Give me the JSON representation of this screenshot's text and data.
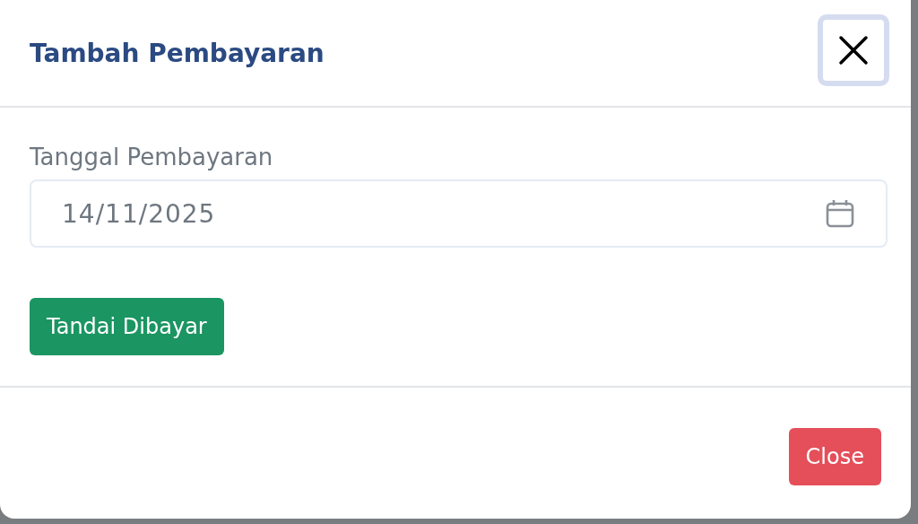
{
  "modal": {
    "title": "Tambah Pembayaran",
    "date_field": {
      "label": "Tanggal Pembayaran",
      "value": "14/11/2025"
    },
    "primary_button": "Tandai Dibayar",
    "footer_button": "Close"
  }
}
